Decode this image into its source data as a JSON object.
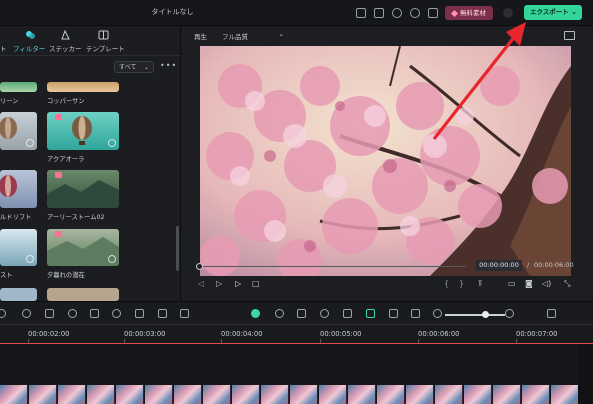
{
  "titlebar": {
    "title": "タイトルなし",
    "free_materials_label": "無料素材",
    "export_label": "エクスポート",
    "export_chevron": "⌄"
  },
  "left_panel": {
    "tabs": [
      {
        "label": "ト"
      },
      {
        "label": "フィルター",
        "active": true
      },
      {
        "label": "ステッカー"
      },
      {
        "label": "テンプレート"
      }
    ],
    "filter_select": "すべて",
    "more": "•••",
    "grid_captions": [
      "リーン",
      "コッパーサン",
      "アクアオーラ",
      "ルドリフト",
      "アーリーストーム02",
      "スト",
      "夕暮れの潜在"
    ]
  },
  "preview": {
    "player_label": "再生",
    "quality": "フル品質",
    "current_time": "00:00:00:00",
    "separator": "/",
    "total_time": "00:00:06:00"
  },
  "timeline": {
    "timecodes": [
      "00:00:02:00",
      "00:00:03:00",
      "00:00:04:00",
      "00:00:05:00",
      "00:00:06:00",
      "00:00:07:00"
    ]
  },
  "colors": {
    "accent": "#33d69a",
    "export_bg": "#33d69a",
    "free_bg": "#7c2f4a",
    "active_tab": "#4fd2e4",
    "playhead": "#e04a4a",
    "annotation_arrow": "#e8262b"
  }
}
